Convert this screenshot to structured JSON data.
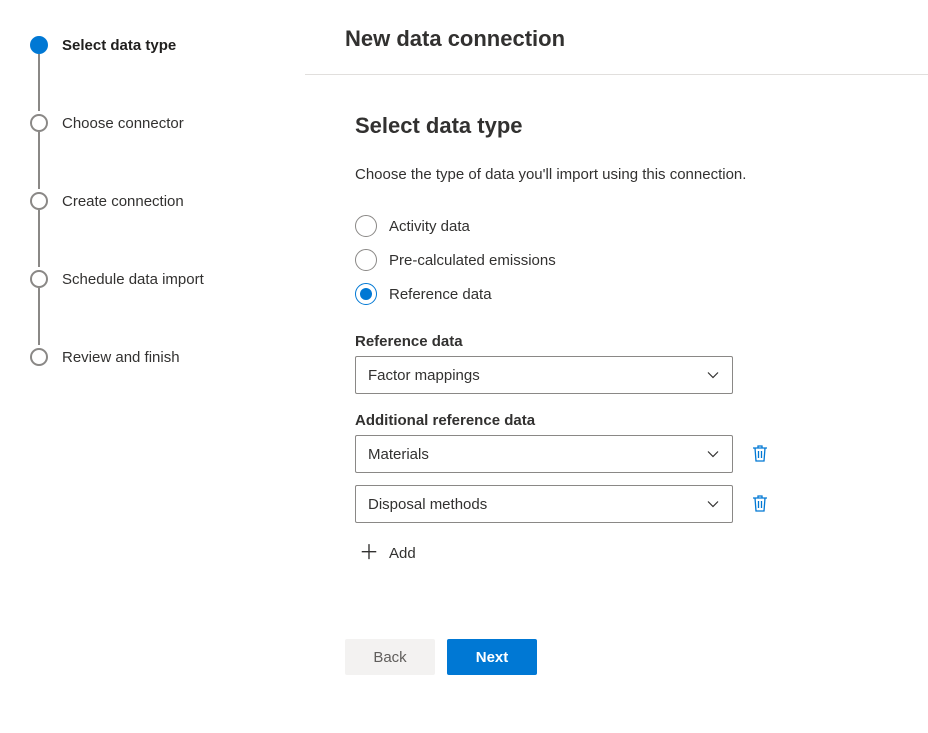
{
  "header": {
    "title": "New data connection"
  },
  "stepper": {
    "steps": [
      {
        "label": "Select data type",
        "active": true
      },
      {
        "label": "Choose connector",
        "active": false
      },
      {
        "label": "Create connection",
        "active": false
      },
      {
        "label": "Schedule data import",
        "active": false
      },
      {
        "label": "Review and finish",
        "active": false
      }
    ]
  },
  "body": {
    "title": "Select data type",
    "description": "Choose the type of data you'll import using this connection.",
    "radios": [
      {
        "label": "Activity data",
        "selected": false
      },
      {
        "label": "Pre-calculated emissions",
        "selected": false
      },
      {
        "label": "Reference data",
        "selected": true
      }
    ],
    "reference_label": "Reference data",
    "reference_value": "Factor mappings",
    "additional_label": "Additional reference data",
    "additional_items": [
      {
        "value": "Materials"
      },
      {
        "value": "Disposal methods"
      }
    ],
    "add_label": "Add"
  },
  "footer": {
    "back": "Back",
    "next": "Next"
  }
}
